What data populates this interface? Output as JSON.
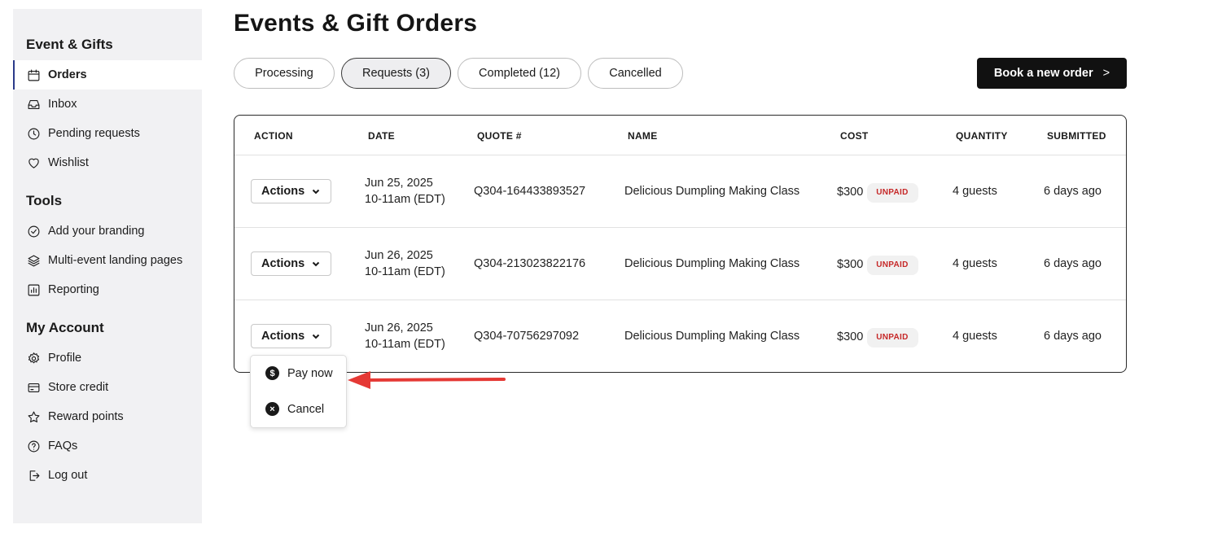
{
  "sidebar": {
    "sections": [
      {
        "heading": "Event & Gifts",
        "items": [
          {
            "label": "Orders",
            "icon": "calendar-icon",
            "active": true
          },
          {
            "label": "Inbox",
            "icon": "inbox-icon"
          },
          {
            "label": "Pending requests",
            "icon": "clock-icon"
          },
          {
            "label": "Wishlist",
            "icon": "heart-icon"
          }
        ]
      },
      {
        "heading": "Tools",
        "items": [
          {
            "label": "Add your branding",
            "icon": "check-circle-icon"
          },
          {
            "label": "Multi-event landing pages",
            "icon": "layers-icon"
          },
          {
            "label": "Reporting",
            "icon": "bar-chart-icon"
          }
        ]
      },
      {
        "heading": "My Account",
        "items": [
          {
            "label": "Profile",
            "icon": "gear-icon"
          },
          {
            "label": "Store credit",
            "icon": "credit-card-icon"
          },
          {
            "label": "Reward points",
            "icon": "star-icon"
          },
          {
            "label": "FAQs",
            "icon": "question-icon"
          },
          {
            "label": "Log out",
            "icon": "logout-icon"
          }
        ]
      }
    ]
  },
  "page": {
    "title": "Events & Gift Orders",
    "tabs": [
      {
        "label": "Processing"
      },
      {
        "label": "Requests (3)",
        "active": true
      },
      {
        "label": "Completed (12)"
      },
      {
        "label": "Cancelled"
      }
    ],
    "book_button": "Book a new order",
    "book_chevron": ">"
  },
  "table": {
    "headers": [
      "ACTION",
      "DATE",
      "QUOTE #",
      "NAME",
      "COST",
      "QUANTITY",
      "SUBMITTED"
    ],
    "rows": [
      {
        "action": "Actions",
        "date": "Jun 25, 2025",
        "time": "10-11am (EDT)",
        "quote": "Q304-164433893527",
        "name": "Delicious Dumpling Making Class",
        "cost": "$300",
        "status": "UNPAID",
        "quantity": "4 guests",
        "submitted": "6 days ago"
      },
      {
        "action": "Actions",
        "date": "Jun 26, 2025",
        "time": "10-11am (EDT)",
        "quote": "Q304-213023822176",
        "name": "Delicious Dumpling Making Class",
        "cost": "$300",
        "status": "UNPAID",
        "quantity": "4 guests",
        "submitted": "6 days ago"
      },
      {
        "action": "Actions",
        "date": "Jun 26, 2025",
        "time": "10-11am (EDT)",
        "quote": "Q304-70756297092",
        "name": "Delicious Dumpling Making Class",
        "cost": "$300",
        "status": "UNPAID",
        "quantity": "4 guests",
        "submitted": "6 days ago"
      }
    ]
  },
  "dropdown": {
    "items": [
      {
        "label": "Pay now",
        "icon": "dollar-icon",
        "glyph": "$"
      },
      {
        "label": "Cancel",
        "icon": "close-circle-icon",
        "glyph": "×"
      }
    ]
  },
  "colors": {
    "accent_arrow": "#e53935",
    "unpaid": "#c62828",
    "active_border": "#2b3a8a"
  }
}
